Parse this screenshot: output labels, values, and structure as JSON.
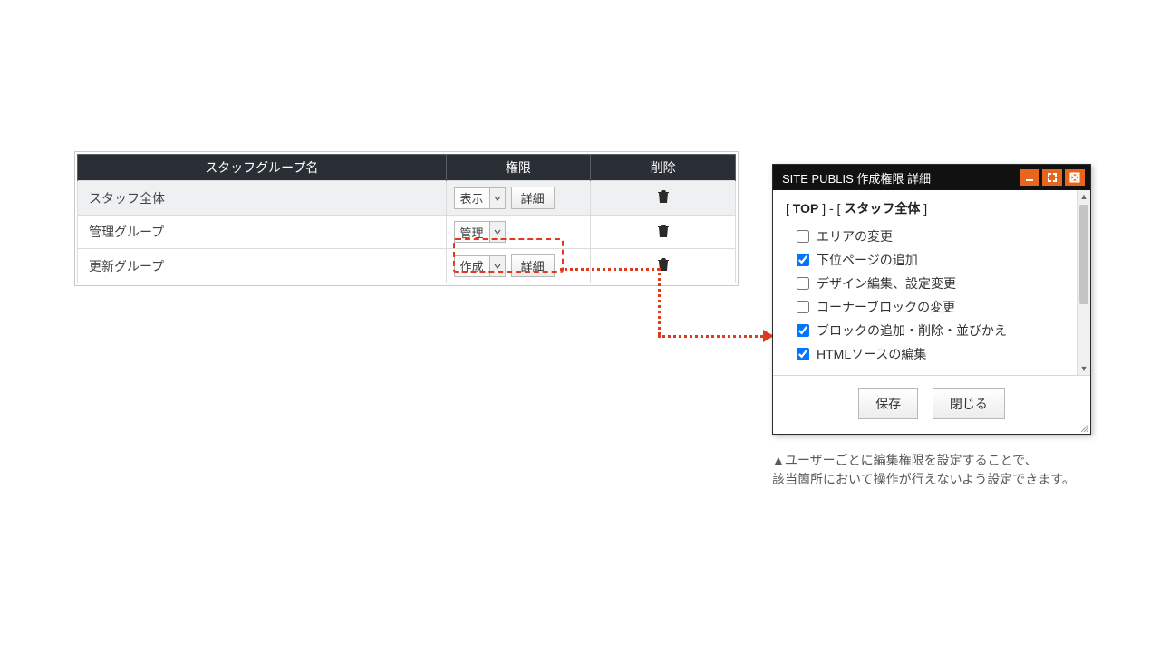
{
  "table": {
    "headers": {
      "name": "スタッフグループ名",
      "perm": "権限",
      "delete": "削除"
    },
    "rows": [
      {
        "name": "スタッフ全体",
        "perm": "表示",
        "detail": "詳細",
        "has_detail": true,
        "alt": true
      },
      {
        "name": "管理グループ",
        "perm": "管理",
        "detail": "",
        "has_detail": false,
        "alt": false
      },
      {
        "name": "更新グループ",
        "perm": "作成",
        "detail": "詳細",
        "has_detail": true,
        "alt": false
      }
    ]
  },
  "popup": {
    "title": "SITE PUBLIS 作成権限 詳細",
    "crumb_top": "TOP",
    "crumb_sep": " - ",
    "crumb_group": "スタッフ全体",
    "perms": [
      {
        "label": "エリアの変更",
        "checked": false
      },
      {
        "label": "下位ページの追加",
        "checked": true
      },
      {
        "label": "デザイン編集、設定変更",
        "checked": false
      },
      {
        "label": "コーナーブロックの変更",
        "checked": false
      },
      {
        "label": "ブロックの追加・削除・並びかえ",
        "checked": true
      },
      {
        "label": "HTMLソースの編集",
        "checked": true
      }
    ],
    "save": "保存",
    "close": "閉じる"
  },
  "caption": {
    "line1": "▲ユーザーごとに編集権限を設定することで、",
    "line2": "該当箇所において操作が行えないよう設定できます。"
  }
}
